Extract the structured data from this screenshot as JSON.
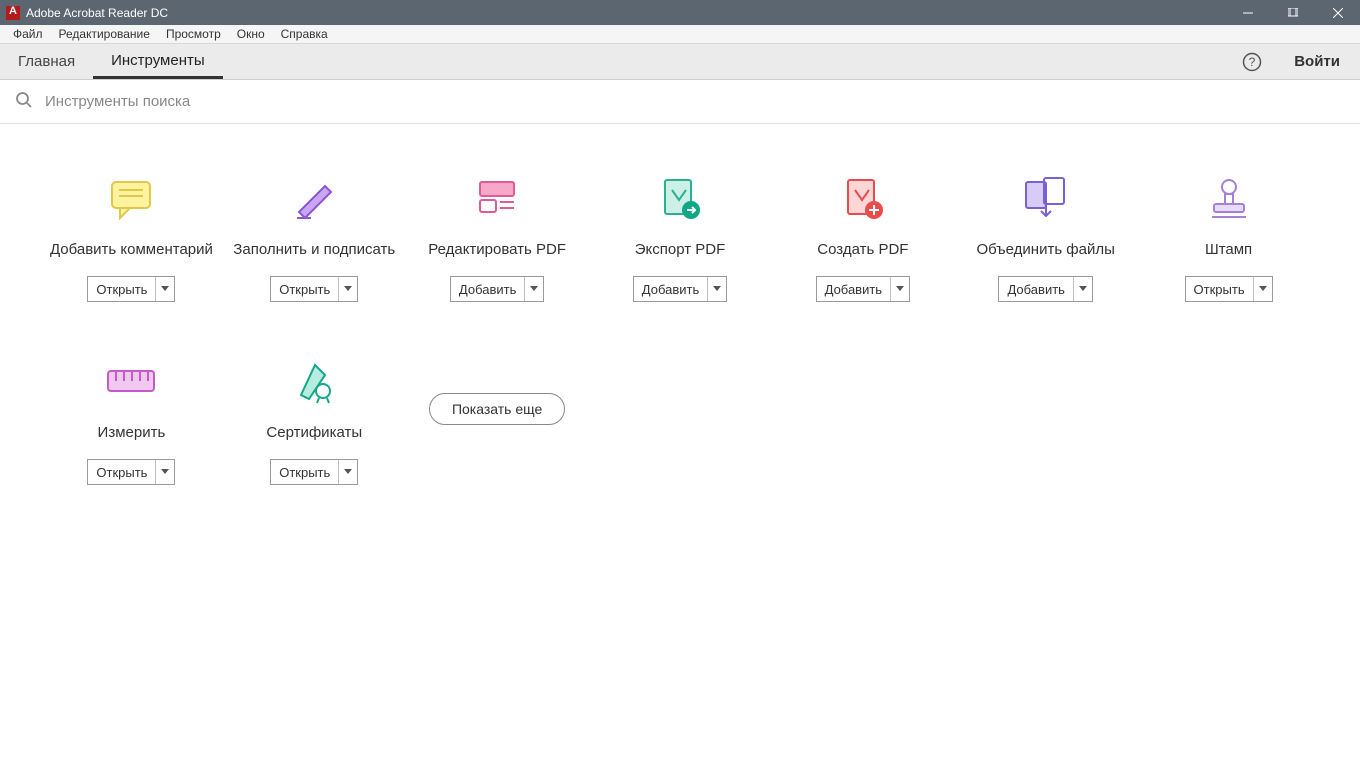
{
  "window": {
    "title": "Adobe Acrobat Reader DC"
  },
  "menu": {
    "file": "Файл",
    "edit": "Редактирование",
    "view": "Просмотр",
    "window": "Окно",
    "help": "Справка"
  },
  "tabs": {
    "home": "Главная",
    "tools": "Инструменты"
  },
  "header": {
    "signin": "Войти"
  },
  "search": {
    "placeholder": "Инструменты поиска"
  },
  "buttons": {
    "open": "Открыть",
    "add": "Добавить",
    "show_more": "Показать еще"
  },
  "tools": {
    "comment": {
      "label": "Добавить комментарий",
      "action": "Открыть"
    },
    "fill_sign": {
      "label": "Заполнить и подписать",
      "action": "Открыть"
    },
    "edit_pdf": {
      "label": "Редактировать PDF",
      "action": "Добавить"
    },
    "export_pdf": {
      "label": "Экспорт PDF",
      "action": "Добавить"
    },
    "create_pdf": {
      "label": "Создать PDF",
      "action": "Добавить"
    },
    "combine": {
      "label": "Объединить файлы",
      "action": "Добавить"
    },
    "stamp": {
      "label": "Штамп",
      "action": "Открыть"
    },
    "measure": {
      "label": "Измерить",
      "action": "Открыть"
    },
    "cert": {
      "label": "Сертификаты",
      "action": "Открыть"
    }
  }
}
